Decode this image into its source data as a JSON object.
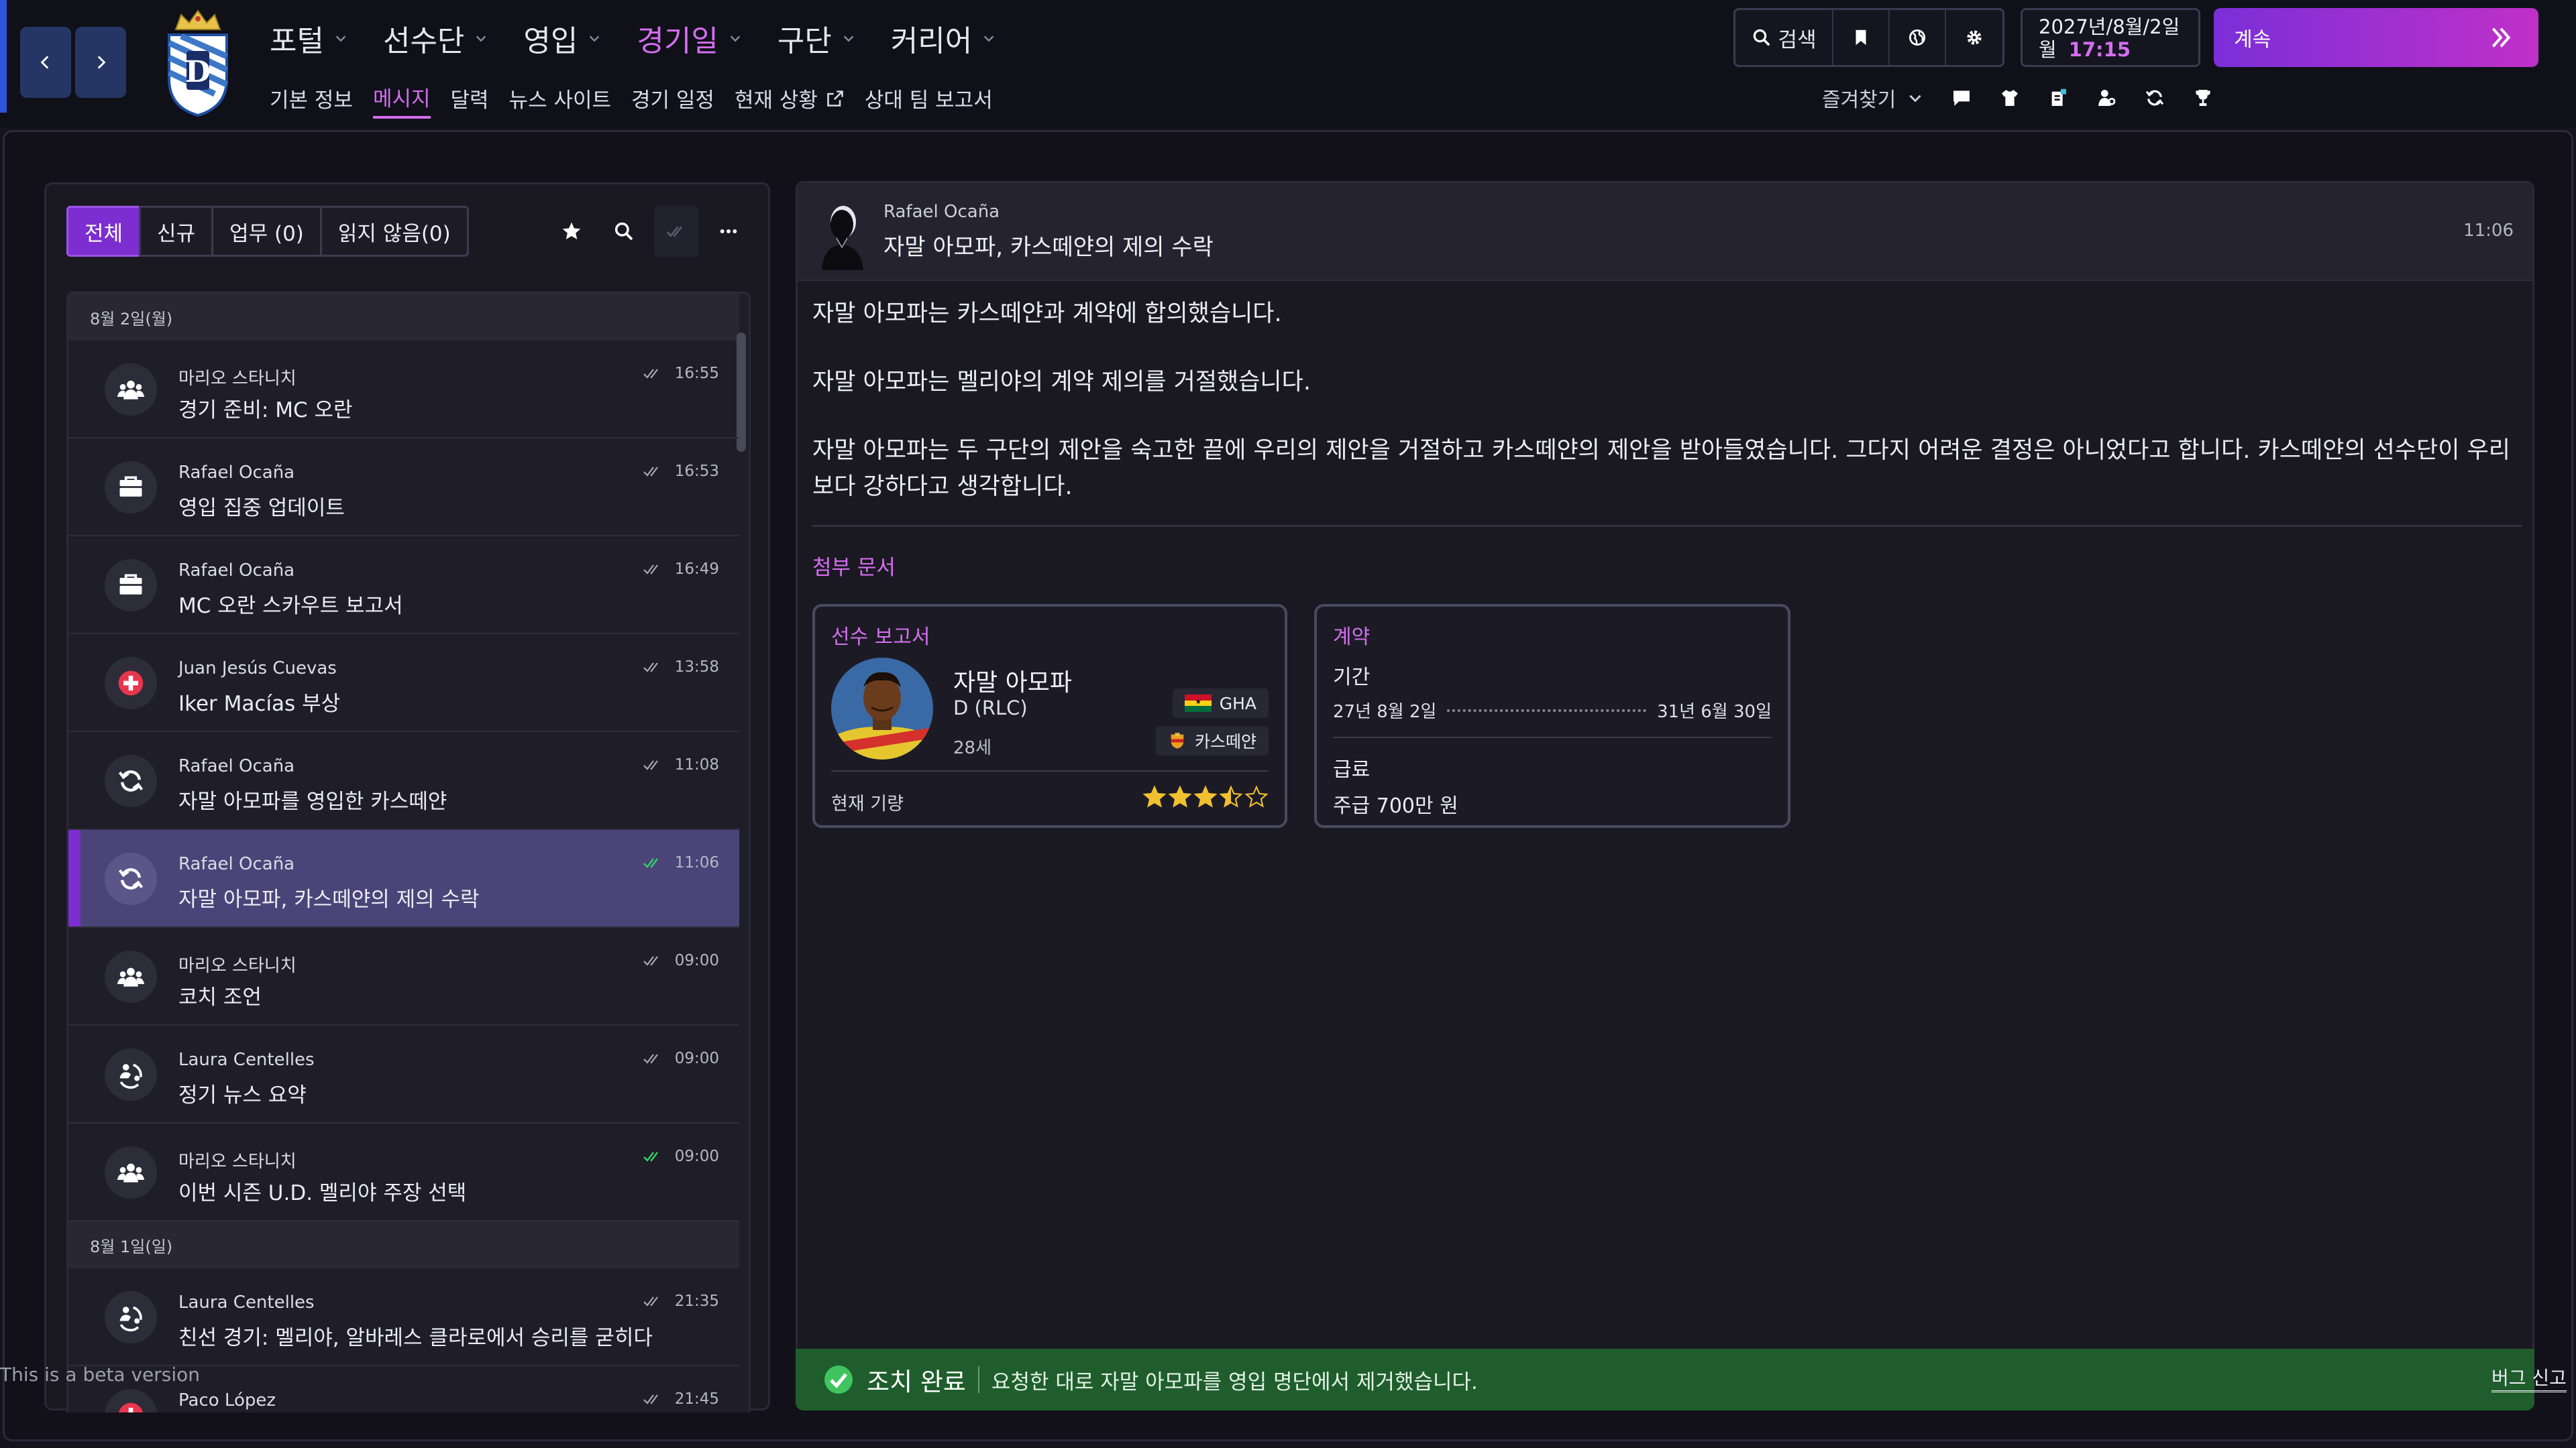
{
  "app": {
    "accent": "#d56ef0",
    "primary": "#7c2ed0",
    "success": "#1f5e2c"
  },
  "topbar": {
    "back_icon": "chevron-left-icon",
    "forward_icon": "chevron-right-icon",
    "main_nav": [
      {
        "label": "포털"
      },
      {
        "label": "선수단"
      },
      {
        "label": "영입"
      },
      {
        "label": "경기일"
      },
      {
        "label": "구단"
      },
      {
        "label": "커리어"
      }
    ],
    "sub_nav": [
      {
        "label": "기본 정보"
      },
      {
        "label": "메시지"
      },
      {
        "label": "달력"
      },
      {
        "label": "뉴스 사이트"
      },
      {
        "label": "경기 일정"
      },
      {
        "label": "현재 상황"
      },
      {
        "label": "상대 팀 보고서"
      }
    ],
    "search_label": "검색",
    "date": "2027년/8월/2일",
    "weekday": "월",
    "time": "17:15",
    "continue_label": "계속",
    "favorites_label": "즐겨찾기"
  },
  "inbox": {
    "filters": [
      {
        "label": "전체"
      },
      {
        "label": "신규"
      },
      {
        "label": "업무 (0)"
      },
      {
        "label": "읽지 않음(0)"
      }
    ],
    "groups": [
      {
        "date": "8월 2일(월)",
        "messages": [
          {
            "sender": "마리오 스타니치",
            "subject": "경기 준비: MC 오란",
            "time": "16:55",
            "icon": "team-icon",
            "read_icon": "double-check-icon"
          },
          {
            "sender": "Rafael Ocaña",
            "subject": "영입 집중 업데이트",
            "time": "16:53",
            "icon": "briefcase-icon",
            "read_icon": "double-check-icon"
          },
          {
            "sender": "Rafael Ocaña",
            "subject": "MC 오란 스카우트 보고서",
            "time": "16:49",
            "icon": "briefcase-icon",
            "read_icon": "double-check-icon"
          },
          {
            "sender": "Juan Jesús Cuevas",
            "subject": "Iker Macías 부상",
            "time": "13:58",
            "icon": "medical-cross-icon",
            "read_icon": "double-check-icon"
          },
          {
            "sender": "Rafael Ocaña",
            "subject": "자말 아모파를 영입한 카스떼얀",
            "time": "11:08",
            "icon": "transfer-cycle-icon",
            "read_icon": "double-check-icon"
          },
          {
            "sender": "Rafael Ocaña",
            "subject": "자말 아모파, 카스떼얀의 제의 수락",
            "time": "11:06",
            "icon": "transfer-cycle-icon",
            "read_icon": "double-check-green-icon"
          },
          {
            "sender": "마리오 스타니치",
            "subject": "코치 조언",
            "time": "09:00",
            "icon": "team-icon",
            "read_icon": "double-check-icon"
          },
          {
            "sender": "Laura Centelles",
            "subject": "정기 뉴스 요약",
            "time": "09:00",
            "icon": "media-icon",
            "read_icon": "double-check-icon"
          },
          {
            "sender": "마리오 스타니치",
            "subject": "이번 시즌 U.D. 멜리야 주장 선택",
            "time": "09:00",
            "icon": "team-icon",
            "read_icon": "double-check-green-icon"
          }
        ]
      },
      {
        "date": "8월 1일(일)",
        "messages": [
          {
            "sender": "Laura Centelles",
            "subject": "친선 경기: 멜리야, 알바레스 클라로에서 승리를 굳히다",
            "time": "21:35",
            "icon": "media-icon",
            "read_icon": "double-check-icon"
          },
          {
            "sender": "Paco López",
            "subject": "",
            "time": "21:45",
            "icon": "medical-cross-icon",
            "read_icon": "double-check-icon"
          }
        ]
      }
    ]
  },
  "message": {
    "sender": "Rafael Ocaña",
    "subject": "자말 아모파, 카스떼얀의 제의 수락",
    "time": "11:06",
    "body": [
      "자말 아모파는 카스떼얀과 계약에 합의했습니다.",
      "자말 아모파는 멜리야의 계약 제의를 거절했습니다.",
      "자말 아모파는 두 구단의 제안을 숙고한 끝에 우리의 제안을 거절하고 카스떼얀의 제안을 받아들였습니다. 그다지 어려운 결정은 아니었다고 합니다. 카스떼얀의 선수단이 우리보다 강하다고 생각합니다."
    ],
    "attachments_title": "첨부 문서",
    "player_report": {
      "title": "선수 보고서",
      "name": "자말 아모파",
      "position": "D (RLC)",
      "age": "28세",
      "nation": "GHA",
      "club": "카스떼얀",
      "ability_label": "현재 기량",
      "ability_stars": 3.5,
      "ability_max": 5
    },
    "contract": {
      "title": "계약",
      "period_label": "기간",
      "start": "27년 8월 2일",
      "end": "31년 6월 30일",
      "wage_label": "급료",
      "wage": "주급 700만 원"
    }
  },
  "action_bar": {
    "status": "조치 완료",
    "text": "요청한 대로 자말 아모파를 영입 명단에서 제거했습니다."
  },
  "footer": {
    "beta": "This is a beta version",
    "bug_report": "버그 신고"
  }
}
